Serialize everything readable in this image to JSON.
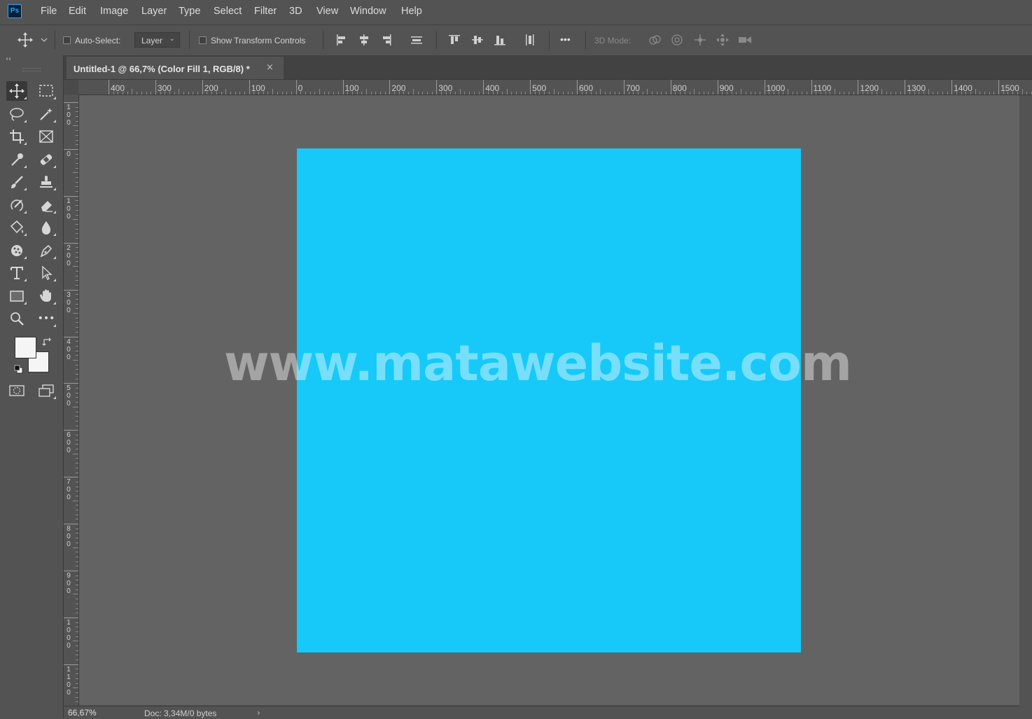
{
  "app": {
    "logo": "Ps"
  },
  "menu": [
    "File",
    "Edit",
    "Image",
    "Layer",
    "Type",
    "Select",
    "Filter",
    "3D",
    "View",
    "Window",
    "Help"
  ],
  "options": {
    "auto_select_label": "Auto-Select:",
    "auto_select_checked": false,
    "layer_select_value": "Layer",
    "show_transform_label": "Show Transform Controls",
    "show_transform_checked": false,
    "more_label": "•••",
    "mode_label": "3D Mode:"
  },
  "document": {
    "tab_title": "Untitled-1 @ 66,7% (Color Fill 1, RGB/8) *",
    "close_glyph": "×",
    "fill_color": "#16c9f8"
  },
  "watermark": "www.matawebsite.com",
  "rulers": {
    "horizontal": [
      "400",
      "300",
      "200",
      "100",
      "0",
      "100",
      "200",
      "300",
      "400",
      "500",
      "600",
      "700",
      "800",
      "900",
      "1000",
      "1100",
      "1200",
      "1300",
      "1400",
      "1500"
    ],
    "vertical": [
      "100",
      "0",
      "100",
      "200",
      "300",
      "400",
      "500",
      "600",
      "700",
      "800",
      "900",
      "1000",
      "1100"
    ]
  },
  "toolbar": {
    "collapse_glyph": "‹‹",
    "more_tools_label": "•••",
    "foreground_color": "#f5f5f5",
    "background_color": "#f5f5f5"
  },
  "status": {
    "zoom": "66,67%",
    "doc_info": "Doc: 3,34M/0 bytes",
    "arrow": "›"
  }
}
